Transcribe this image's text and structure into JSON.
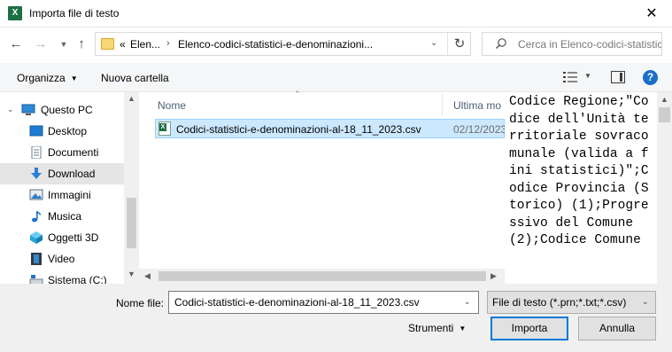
{
  "window": {
    "title": "Importa file di testo",
    "app_icon": "X",
    "close": "✕"
  },
  "address": {
    "overflow": "«",
    "parts": [
      "Elen...",
      "Elenco-codici-statistici-e-denominazioni..."
    ],
    "separator": "›"
  },
  "search": {
    "placeholder": "Cerca in Elenco-codici-statistici-e-..."
  },
  "toolbar": {
    "organize": "Organizza",
    "new_folder": "Nuova cartella"
  },
  "navpane": {
    "items": [
      {
        "label": "Questo PC",
        "icon": "pc-icon"
      },
      {
        "label": "Desktop",
        "icon": "desktop-icon"
      },
      {
        "label": "Documenti",
        "icon": "documents-icon"
      },
      {
        "label": "Download",
        "icon": "download-icon",
        "selected": true
      },
      {
        "label": "Immagini",
        "icon": "pictures-icon"
      },
      {
        "label": "Musica",
        "icon": "music-icon"
      },
      {
        "label": "Oggetti 3D",
        "icon": "3d-objects-icon"
      },
      {
        "label": "Video",
        "icon": "video-icon"
      },
      {
        "label": "Sistema (C:)",
        "icon": "drive-icon"
      }
    ]
  },
  "filelist": {
    "columns": [
      "Nome",
      "Ultima mo"
    ],
    "files": [
      {
        "name": "Codici-statistici-e-denominazioni-al-18_11_2023.csv",
        "modified": "02/12/2023",
        "selected": true
      }
    ]
  },
  "preview": {
    "text": "Codice Regione;\"Codice dell'Unità territoriale sovracomunale (valida a fini statistici)\";Codice Provincia (Storico) (1);Progressivo del Comune (2);Codice Comune"
  },
  "bottom": {
    "filename_label": "Nome file:",
    "filename_value": "Codici-statistici-e-denominazioni-al-18_11_2023.csv",
    "filter_value": "File di testo (*.prn;*.txt;*.csv)",
    "tools": "Strumenti",
    "open": "Importa",
    "cancel": "Annulla"
  },
  "colors": {
    "selection": "#cce8ff",
    "accent": "#0078d7",
    "excel_green": "#1d7044"
  }
}
